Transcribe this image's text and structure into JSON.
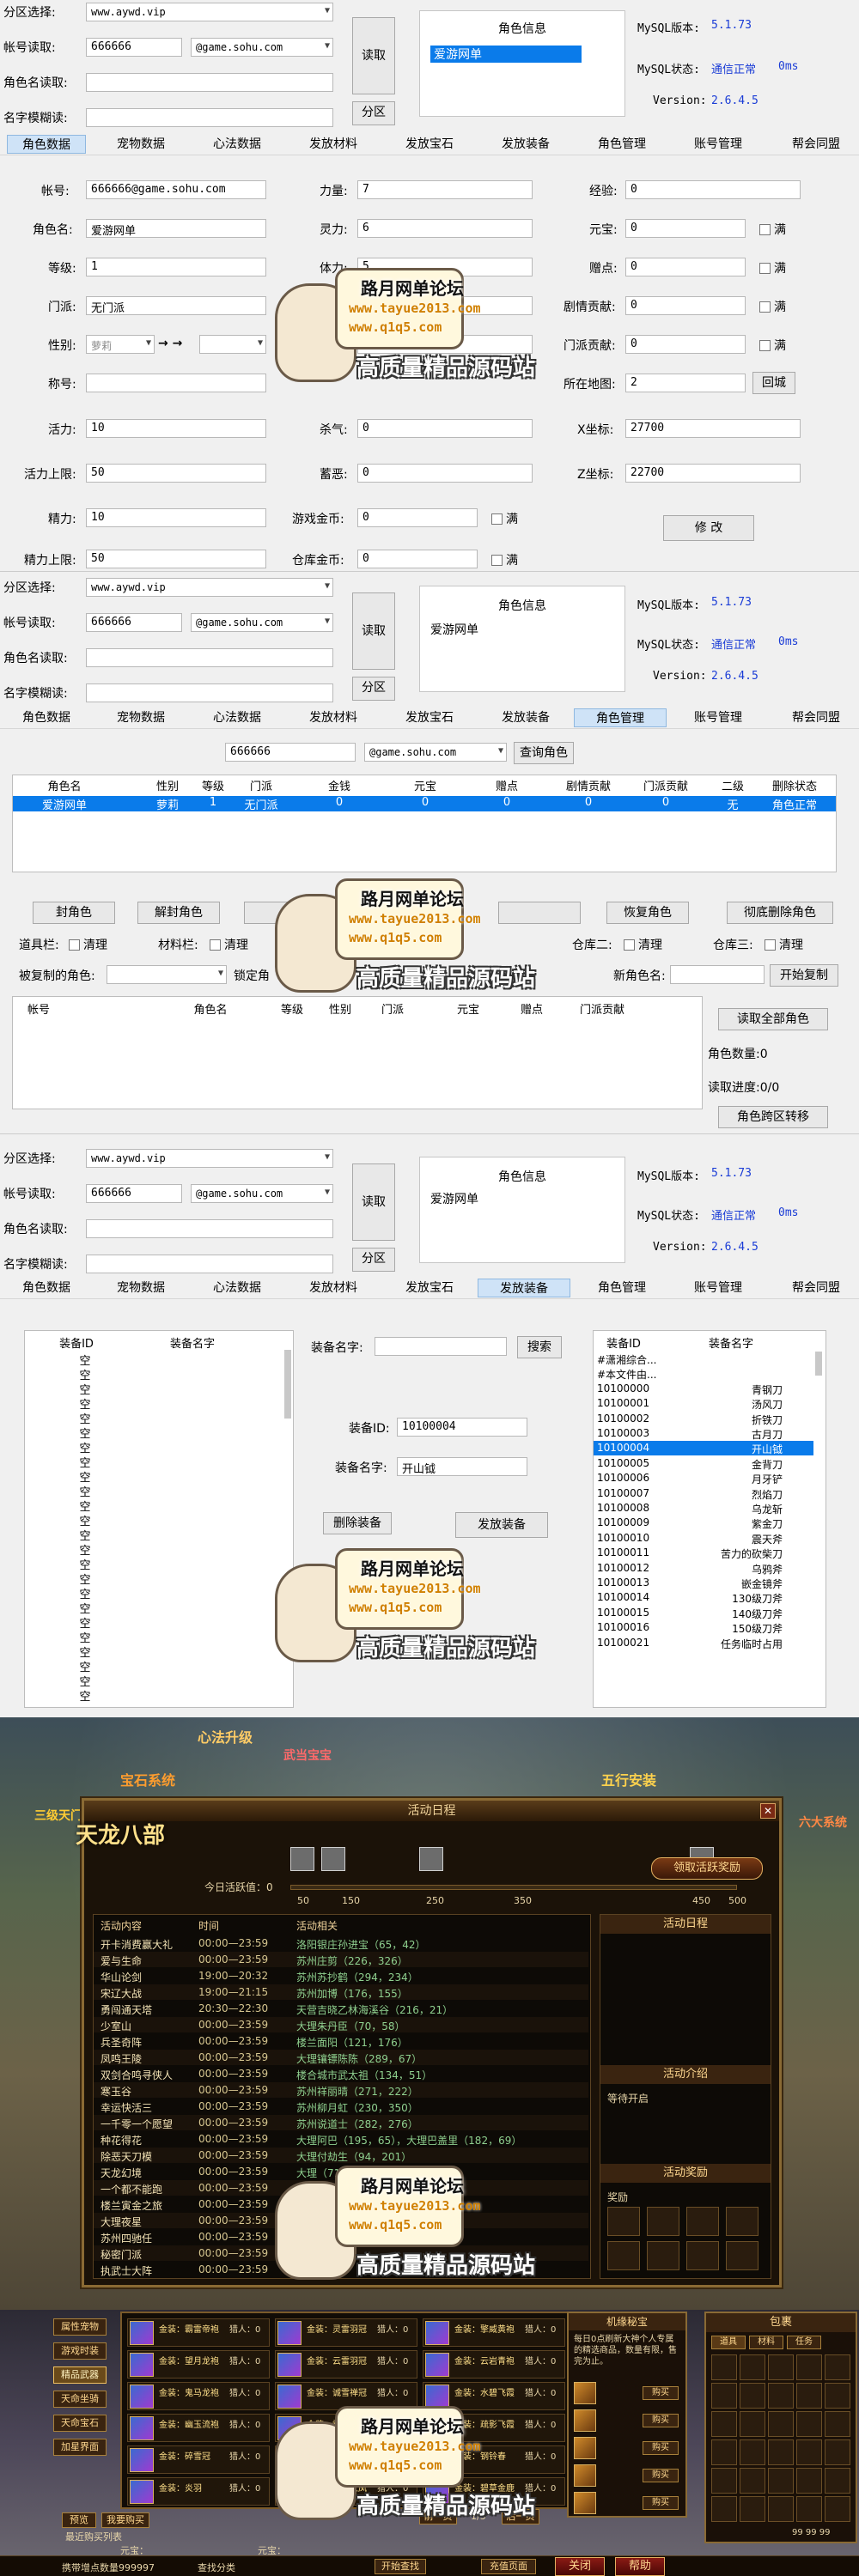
{
  "panel_common": {
    "zone_label": "分区选择:",
    "zone_value": "www.aywd.vip",
    "account_label": "帐号读取:",
    "account_value": "666666",
    "domain_value": "@game.sohu.com",
    "rolename_label": "角色名读取:",
    "fuzzy_label": "名字模糊读:",
    "read_btn": "读取",
    "zone_btn": "分区",
    "roleinfo_title": "角色信息",
    "roleinfo_item": "爱游网单",
    "mysql_version_label": "MySQL版本:",
    "mysql_version": "5.1.73",
    "mysql_status_label": "MySQL状态:",
    "mysql_status": "通信正常",
    "mysql_ms": "0ms",
    "version_label": "Version:",
    "version": "2.6.4.5"
  },
  "tabs": [
    "角色数据",
    "宠物数据",
    "心法数据",
    "发放材料",
    "发放宝石",
    "发放装备",
    "角色管理",
    "账号管理",
    "帮会同盟"
  ],
  "role_data": {
    "account_label": "帐号:",
    "account": "666666@game.sohu.com",
    "name_label": "角色名:",
    "name": "爱游网单",
    "level_label": "等级:",
    "level": "1",
    "sect_label": "门派:",
    "sect": "无门派",
    "gender_label": "性别:",
    "gender": "萝莉",
    "arrow": "→ →",
    "title_label": "称号:",
    "vitality_label": "活力:",
    "vitality": "10",
    "vitality_max_label": "活力上限:",
    "vitality_max": "50",
    "energy_label": "精力:",
    "energy": "10",
    "energy_max_label": "精力上限:",
    "energy_max": "50",
    "strength_label": "力量:",
    "strength": "7",
    "spirit_label": "灵力:",
    "spirit": "6",
    "stamina_label": "体力:",
    "stamina": "5",
    "row4_value": "3",
    "row5_value": "2",
    "kill_label": "杀气:",
    "kill": "0",
    "hunger_label": "蓄恶:",
    "hunger": "0",
    "gold_label": "游戏金币:",
    "gold": "0",
    "bank_label": "仓库金币:",
    "bank": "0",
    "exp_label": "经验:",
    "exp": "0",
    "yuanbao_label": "元宝:",
    "yuanbao": "0",
    "points_label": "赠点:",
    "points": "0",
    "plot_label": "剧情贡献:",
    "plot": "0",
    "sect_contrib_label": "门派贡献:",
    "sect_contrib": "0",
    "map_label": "所在地图:",
    "map": "2",
    "x_label": "X坐标:",
    "x": "27700",
    "z_label": "Z坐标:",
    "z": "22700",
    "full_label": "满",
    "return_btn": "回城",
    "modify_btn": "修 改"
  },
  "role_manage": {
    "account": "666666",
    "domain": "@game.sohu.com",
    "query_btn": "查询角色",
    "headers": [
      "角色名",
      "性别",
      "等级",
      "门派",
      "金钱",
      "元宝",
      "赠点",
      "剧情贡献",
      "门派贡献",
      "二级",
      "删除状态"
    ],
    "row": [
      "爱游网单",
      "萝莉",
      "1",
      "无门派",
      "0",
      "0",
      "0",
      "0",
      "0",
      "无",
      "角色正常"
    ],
    "buttons": [
      "封角色",
      "解封角色",
      "",
      "",
      "",
      "恢复角色",
      "彻底删除角色"
    ],
    "item_bar": "道具栏:",
    "material_bar": "材料栏:",
    "clear": "清理",
    "warehouse2": "仓库二:",
    "warehouse3": "仓库三:",
    "copied_label": "被复制的角色:",
    "lock_label": "锁定角",
    "newname_label": "新角色名:",
    "start_copy": "开始复制",
    "list_headers": [
      "帐号",
      "角色名",
      "等级",
      "性别",
      "门派",
      "元宝",
      "赠点",
      "门派贡献"
    ],
    "read_all": "读取全部角色",
    "count_label": "角色数量:0",
    "progress_label": "读取进度:0/0",
    "transfer": "角色跨区转移"
  },
  "equip": {
    "left_headers": [
      "装备ID",
      "装备名字"
    ],
    "empty": "空",
    "name_label": "装备名字:",
    "search": "搜索",
    "id_label": "装备ID:",
    "id": "10100004",
    "name2_label": "装备名字:",
    "name2": "开山钺",
    "delete": "删除装备",
    "send": "发放装备",
    "right_headers": [
      "装备ID",
      "装备名字"
    ],
    "rows": [
      [
        "#潇湘综合...",
        ""
      ],
      [
        "#本文件由...",
        ""
      ],
      [
        "10100000",
        "青钢刀"
      ],
      [
        "10100001",
        "汤风刀"
      ],
      [
        "10100002",
        "折铁刀"
      ],
      [
        "10100003",
        "古月刀"
      ],
      [
        "10100004",
        "开山钺"
      ],
      [
        "10100005",
        "金背刀"
      ],
      [
        "10100006",
        "月牙铲"
      ],
      [
        "10100007",
        "烈焰刀"
      ],
      [
        "10100008",
        "乌龙斩"
      ],
      [
        "10100009",
        "紫金刀"
      ],
      [
        "10100010",
        "震天斧"
      ],
      [
        "10100011",
        "苦力的砍柴刀"
      ],
      [
        "10100012",
        "乌鸦斧"
      ],
      [
        "10100013",
        "嵌金镜斧"
      ],
      [
        "10100014",
        "130级刀斧"
      ],
      [
        "10100015",
        "140级刀斧"
      ],
      [
        "10100016",
        "150级刀斧"
      ],
      [
        "10100021",
        "任务临时占用"
      ]
    ]
  },
  "watermark": {
    "t1": "路月网单论坛",
    "t2": "www.tayue2013.com",
    "t3": "www.q1q5.com",
    "t4": "高质量精品源码站"
  },
  "game1": {
    "title": "活动日程",
    "logo": "天龙八部",
    "today": "今日活跃值：0",
    "ticks": [
      "50",
      "150",
      "250",
      "350",
      "450",
      "500"
    ],
    "reward_btn": "领取活跃奖励",
    "headers": [
      "活动内容",
      "时间",
      "活动相关"
    ],
    "rows": [
      [
        "开卡消费赢大礼",
        "00:00—23:59",
        "洛阳银庄孙进宝（65，42）"
      ],
      [
        "爱与生命",
        "00:00—23:59",
        "苏州庄剪（226，326）"
      ],
      [
        "华山论剑",
        "19:00—20:32",
        "苏州苏抄鹤（294，234）"
      ],
      [
        "宋辽大战",
        "19:00—21:15",
        "苏州加博（176，155）"
      ],
      [
        "勇闯通天塔",
        "20:30—22:30",
        "天营吉晓乙林海溪谷（216，21）"
      ],
      [
        "少室山",
        "00:00—23:59",
        "大理朱丹臣（70，58）"
      ],
      [
        "兵圣奇阵",
        "00:00—23:59",
        "楼兰面阳（121，176）"
      ],
      [
        "凤鸣王陵",
        "00:00—23:59",
        "大理镶镖陈陈（289，67）"
      ],
      [
        "双剑合鸣寻侠人",
        "00:00—23:59",
        "楼合城市武太祖（134，51）"
      ],
      [
        "寒玉谷",
        "00:00—23:59",
        "苏州祥丽晴（271，222）"
      ],
      [
        "幸运快活三",
        "00:00—23:59",
        "苏州柳月虹（230，350）"
      ],
      [
        "一千零一个愿望",
        "00:00—23:59",
        "苏州说道士（282，276）"
      ],
      [
        "种花得花",
        "00:00—23:59",
        "大理阿巴（195，65），大理巴盖里（182，69）"
      ],
      [
        "除恶天刀模",
        "00:00—23:59",
        "大理付劫生（94，201）"
      ],
      [
        "天龙幻境",
        "00:00—23:59",
        "大理（71，120）"
      ],
      [
        "一个都不能跑",
        "00:00—23:59",
        ""
      ],
      [
        "楼兰寅金之旅",
        "00:00—23:59",
        ""
      ],
      [
        "大理夜星",
        "00:00—23:59",
        ""
      ],
      [
        "苏州四驰任",
        "00:00—23:59",
        ""
      ],
      [
        "秘密门派",
        "00:00—23:59",
        ""
      ],
      [
        "执武士大阵",
        "00:00—23:59",
        ""
      ]
    ],
    "side_title1": "活动日程",
    "side_title2": "活动介绍",
    "wait": "等待开启",
    "side_title3": "活动奖励",
    "reward_lbl": "奖励",
    "float_tags": [
      "心法升级",
      "宝石系统",
      "五行安装",
      "武当宝宝",
      "三级天门",
      "六大系统"
    ]
  },
  "game2": {
    "left_btns": [
      "属性宠物",
      "游戏时装",
      "精品武器",
      "天命坐骑",
      "天命宝石",
      "加星界面"
    ],
    "slots": [
      [
        "金装：霸雷帝袍",
        "猎人：0"
      ],
      [
        "金装：灵雷羽冠",
        "猎人：0"
      ],
      [
        "金装：擎威黄袍",
        "猎人：0"
      ],
      [
        "金装：望月龙袍",
        "猎人：0"
      ],
      [
        "金装：云雷羽冠",
        "猎人：0"
      ],
      [
        "金装：云岩青袍",
        "猎人：0"
      ],
      [
        "金装：鬼马龙袍",
        "猎人：0"
      ],
      [
        "金装：诚雪禅冠",
        "猎人：0"
      ],
      [
        "金装：水碧飞霞",
        "猎人：0"
      ],
      [
        "金装：幽玉流袍",
        "猎人：0"
      ],
      [
        "金装：霜羽冠",
        "猎人：0"
      ],
      [
        "金装：疏影飞霞",
        "猎人：0"
      ],
      [
        "金装：碎雪冠",
        "猎人：0"
      ],
      [
        "金装：阳雷朱袍",
        "猎人：0"
      ],
      [
        "金装：钢铃春",
        "猎人：0"
      ],
      [
        "金装：炎羽",
        "猎人：0"
      ],
      [
        "金装：天瑟火凤",
        "猎人：0"
      ],
      [
        "金装：碧草金鹿",
        "猎人：0"
      ]
    ],
    "preview": "预览",
    "my_buy": "我要购买",
    "page_prev": "前一页",
    "page": "1/3",
    "page_next": "后一页",
    "recent": "最近购买列表",
    "yuanbao": "元宝：",
    "yuanbao2": "元宝：",
    "shop_title": "机缘秘宝",
    "shop_desc": "每日0点刷新大神个人专属的精选商品，数量有限，售完为止。",
    "buy": "购买",
    "bag_title": "包裹",
    "bag_tabs": [
      "道具",
      "材料",
      "任务"
    ],
    "bottom_left": "携带增点数量999997",
    "bottom_mid": "查找分类",
    "bottom_btn": "开始查找",
    "bottom_right": "充值页面",
    "bag_btn1": "关闭",
    "bag_btn2": "帮助",
    "money": "99  99  99"
  }
}
